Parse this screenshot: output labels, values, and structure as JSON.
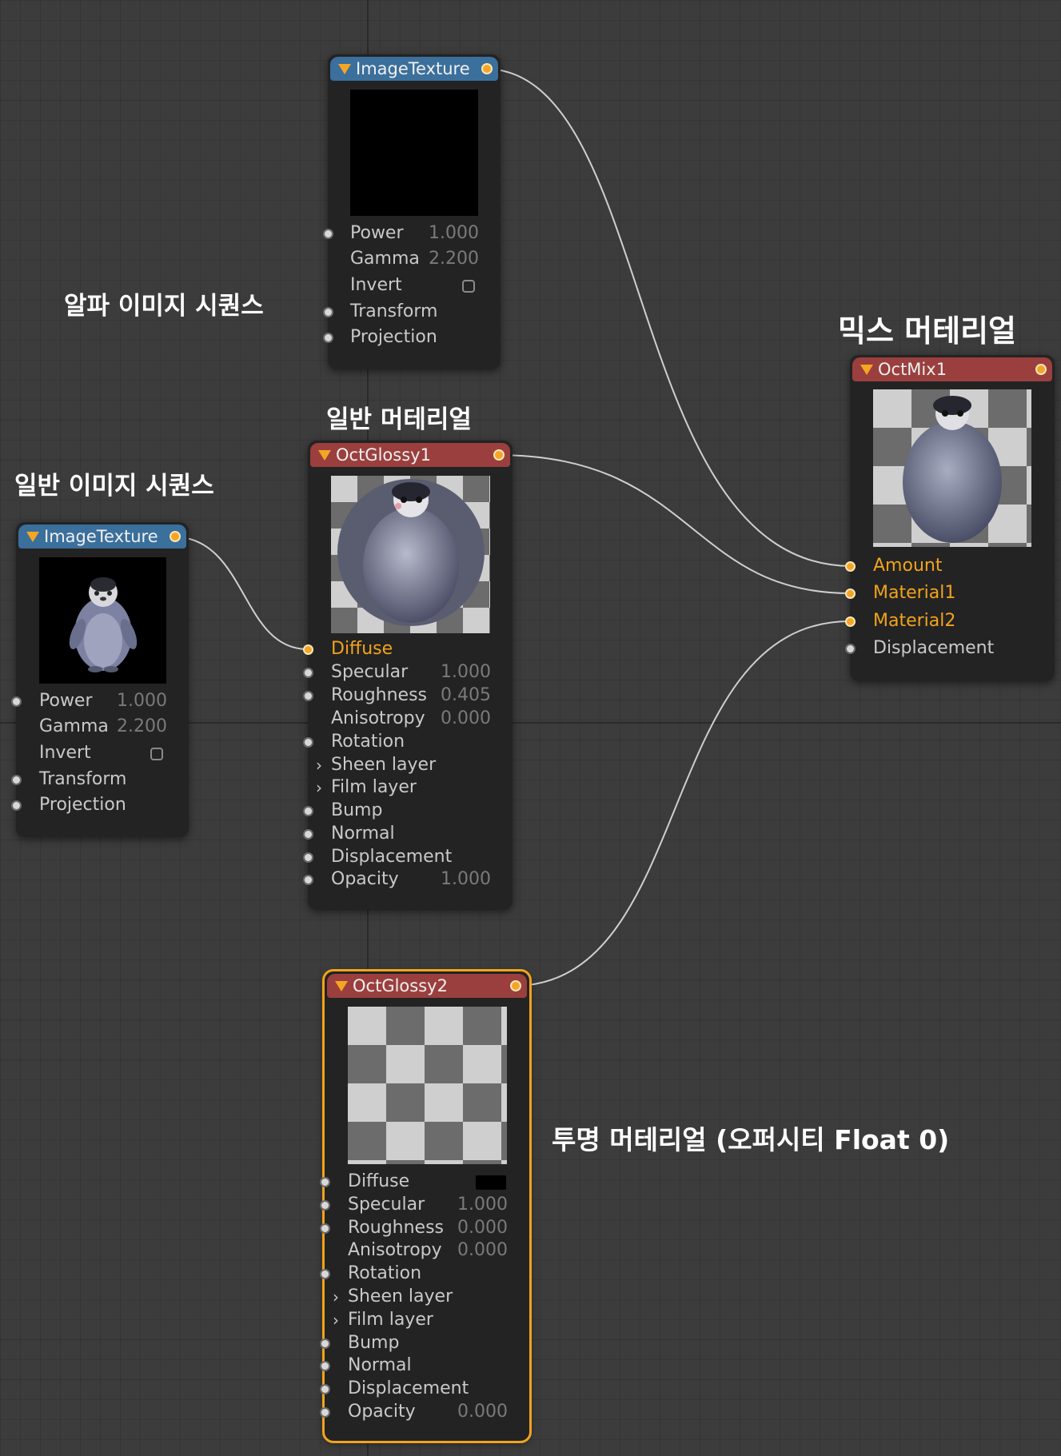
{
  "captions": {
    "alpha_sequence": "알파 이미지 시퀀스",
    "normal_sequence": "일반 이미지 시퀀스",
    "normal_material": "일반 머테리얼",
    "mix_material": "믹스 머테리얼",
    "transparent_material": "투명 머테리얼 (오퍼시티 Float 0)"
  },
  "nodes": {
    "image_texture_alpha": {
      "title": "ImageTexture",
      "header_color": "#3b6f9c",
      "preview": "black image",
      "power": {
        "label": "Power",
        "value": "1.000"
      },
      "gamma": {
        "label": "Gamma",
        "value": "2.200"
      },
      "invert": {
        "label": "Invert",
        "checked": false
      },
      "transform": {
        "label": "Transform"
      },
      "projection": {
        "label": "Projection"
      }
    },
    "image_texture_normal": {
      "title": "ImageTexture",
      "header_color": "#3b6f9c",
      "preview": "penguin on black",
      "power": {
        "label": "Power",
        "value": "1.000"
      },
      "gamma": {
        "label": "Gamma",
        "value": "2.200"
      },
      "invert": {
        "label": "Invert",
        "checked": false
      },
      "transform": {
        "label": "Transform"
      },
      "projection": {
        "label": "Projection"
      }
    },
    "oct_glossy1": {
      "title": "OctGlossy1",
      "header_color": "#9a3f3e",
      "preview": "penguin sphere on checker",
      "diffuse": {
        "label": "Diffuse"
      },
      "specular": {
        "label": "Specular",
        "value": "1.000"
      },
      "roughness": {
        "label": "Roughness",
        "value": "0.405"
      },
      "anisotropy": {
        "label": "Anisotropy",
        "value": "0.000"
      },
      "rotation": {
        "label": "Rotation"
      },
      "sheen": {
        "label": "Sheen layer"
      },
      "film": {
        "label": "Film layer"
      },
      "bump": {
        "label": "Bump"
      },
      "normal": {
        "label": "Normal"
      },
      "displacement": {
        "label": "Displacement"
      },
      "opacity": {
        "label": "Opacity",
        "value": "1.000"
      }
    },
    "oct_glossy2": {
      "title": "OctGlossy2",
      "header_color": "#9a3f3e",
      "selected": true,
      "preview": "checker (transparent)",
      "diffuse": {
        "label": "Diffuse",
        "swatch": "#000000"
      },
      "specular": {
        "label": "Specular",
        "value": "1.000"
      },
      "roughness": {
        "label": "Roughness",
        "value": "0.000"
      },
      "anisotropy": {
        "label": "Anisotropy",
        "value": "0.000"
      },
      "rotation": {
        "label": "Rotation"
      },
      "sheen": {
        "label": "Sheen layer"
      },
      "film": {
        "label": "Film layer"
      },
      "bump": {
        "label": "Bump"
      },
      "normal": {
        "label": "Normal"
      },
      "displacement": {
        "label": "Displacement"
      },
      "opacity": {
        "label": "Opacity",
        "value": "0.000"
      }
    },
    "oct_mix1": {
      "title": "OctMix1",
      "header_color": "#9a3f3e",
      "preview": "penguin on checker",
      "amount": {
        "label": "Amount"
      },
      "material1": {
        "label": "Material1"
      },
      "material2": {
        "label": "Material2"
      },
      "displacement": {
        "label": "Displacement"
      }
    }
  },
  "connections": [
    {
      "from": "image_texture_alpha.out",
      "to": "oct_mix1.amount"
    },
    {
      "from": "image_texture_normal.out",
      "to": "oct_glossy1.diffuse"
    },
    {
      "from": "oct_glossy1.out",
      "to": "oct_mix1.material1"
    },
    {
      "from": "oct_glossy2.out",
      "to": "oct_mix1.material2"
    }
  ],
  "colors": {
    "background": "#3c3c3c",
    "accent_port": "#f3a52a",
    "selection": "#f2a31c",
    "texture_header": "#3b6f9c",
    "material_header": "#9a3f3e"
  }
}
